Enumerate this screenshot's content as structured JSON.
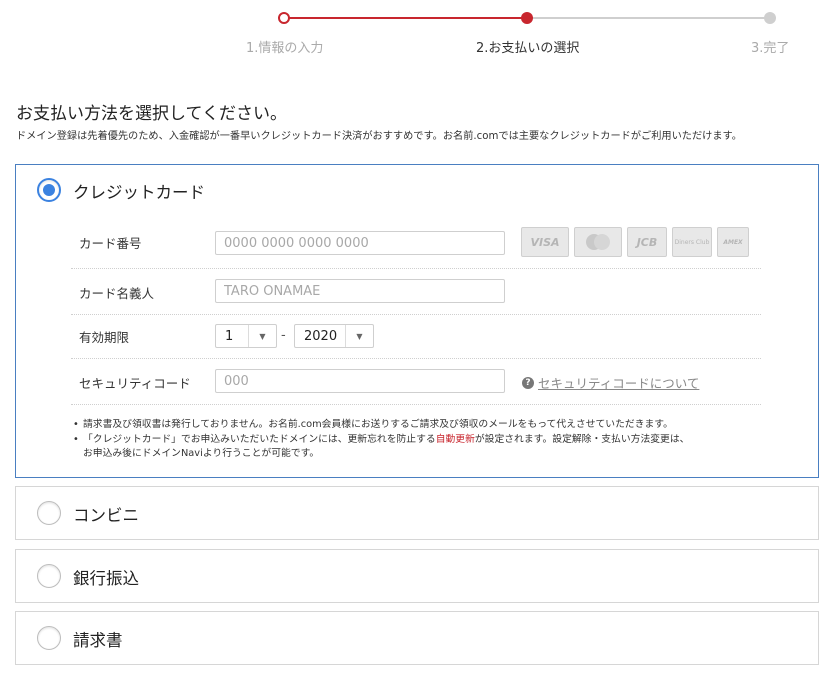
{
  "stepper": {
    "steps": [
      {
        "label": "1.情報の入力"
      },
      {
        "label": "2.お支払いの選択"
      },
      {
        "label": "3.完了"
      }
    ]
  },
  "page": {
    "title": "お支払い方法を選択してください。",
    "intro": "ドメイン登録は先着優先のため、入金確認が一番早いクレジットカード決済がおすすめです。お名前.comでは主要なクレジットカードがご利用いただけます。"
  },
  "credit_card": {
    "title": "クレジットカード",
    "number_label": "カード番号",
    "number_placeholder": "0000 0000 0000 0000",
    "brands": [
      "VISA",
      "mastercard",
      "JCB",
      "Diners Club",
      "AMEX"
    ],
    "holder_label": "カード名義人",
    "holder_placeholder": "TARO ONAMAE",
    "expiry_label": "有効期限",
    "expiry_month": "1",
    "expiry_separator": "-",
    "expiry_year": "2020",
    "security_label": "セキュリティコード",
    "security_placeholder": "000",
    "security_help": "セキュリティコードについて",
    "note1": "請求書及び領収書は発行しておりません。お名前.com会員様にお送りするご請求及び領収のメールをもって代えさせていただきます。",
    "note2_a": "「クレジットカード」でお申込みいただいたドメインには、更新忘れを防止する",
    "note2_red": "自動更新",
    "note2_b": "が設定されます。設定解除・支払い方法変更は、",
    "note2_c": "お申込み後にドメインNaviより行うことが可能です。"
  },
  "options": [
    {
      "label": "コンビニ"
    },
    {
      "label": "銀行振込"
    },
    {
      "label": "請求書"
    }
  ],
  "colors": {
    "accent_red": "#c8262e",
    "accent_blue": "#3b82e0"
  }
}
